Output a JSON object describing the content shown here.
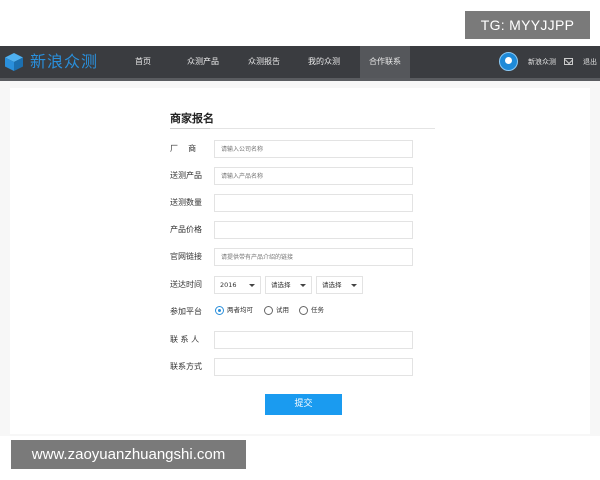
{
  "overlay": {
    "tg_badge": "TG: MYYJJPP",
    "watermark": "www.zaoyuanzhuangshi.com"
  },
  "nav": {
    "logo_text": "新浪众测",
    "items": [
      "首页",
      "众测产品",
      "众测报告",
      "我的众测",
      "合作联系"
    ],
    "active_item": "合作联系",
    "user_name": "新浪众测",
    "logout": "退出"
  },
  "form": {
    "title": "商家报名",
    "fields": {
      "factory": {
        "label": "厂    商",
        "placeholder": "请输入公司名称"
      },
      "product": {
        "label": "送测产品",
        "placeholder": "请输入产品名称"
      },
      "quantity": {
        "label": "送测数量",
        "placeholder": ""
      },
      "price": {
        "label": "产品价格",
        "placeholder": ""
      },
      "website": {
        "label": "官网链接",
        "placeholder": "请提供带有产品介绍的链接"
      },
      "arrival": {
        "label": "送达时间",
        "year": "2016",
        "month": "请选择",
        "day": "请选择"
      },
      "platform": {
        "label": "参加平台",
        "options": [
          "两者均可",
          "试用",
          "任务"
        ],
        "selected": "两者均可"
      },
      "contact_person": {
        "label": "联 系 人",
        "placeholder": ""
      },
      "contact_method": {
        "label": "联系方式",
        "placeholder": ""
      }
    },
    "submit_label": "提交"
  },
  "colors": {
    "nav_bg": "#3a3c40",
    "brand_blue": "#2a8fdb",
    "submit_blue": "#1a9bf0"
  }
}
